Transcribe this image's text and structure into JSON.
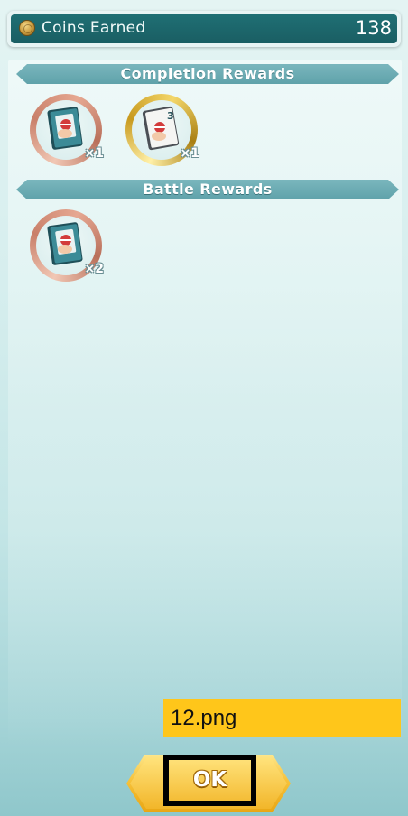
{
  "coins_bar": {
    "label": "Coins Earned",
    "value": "138",
    "icon": "coin-icon"
  },
  "completion_rewards": {
    "title": "Completion Rewards",
    "items": [
      {
        "icon": "book-item-icon",
        "quantity": "×1",
        "ring": "copper"
      },
      {
        "icon": "ticket-item-icon",
        "quantity": "×1",
        "ring": "gold"
      }
    ]
  },
  "battle_rewards": {
    "title": "Battle Rewards",
    "items": [
      {
        "icon": "book-item-icon",
        "quantity": "×2",
        "ring": "copper"
      }
    ]
  },
  "file_label": "12.png",
  "ok_button": {
    "label": "OK"
  },
  "colors": {
    "coins_bar_fill": "#1f6f74",
    "section_header": "#6aa9b0",
    "ok_button": "#f6c23a",
    "label_background": "#ffc61a"
  }
}
